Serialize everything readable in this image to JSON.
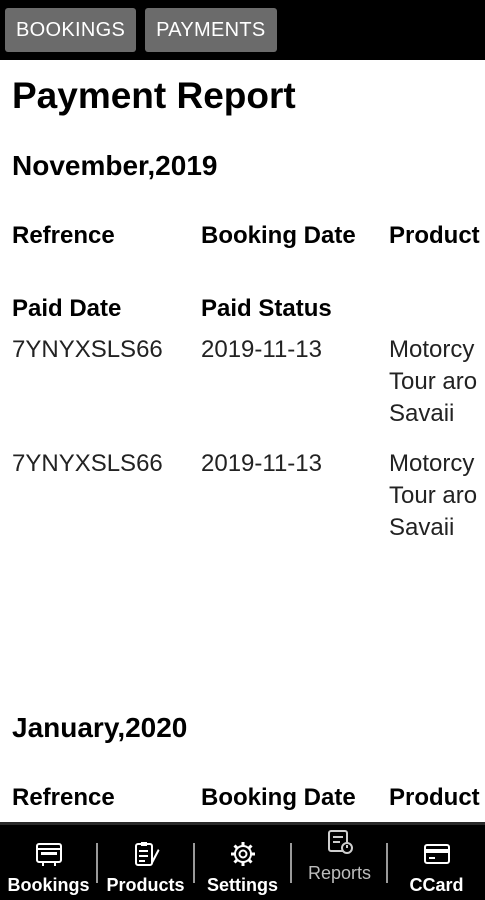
{
  "topbar": {
    "tabs": [
      {
        "label": "BOOKINGS"
      },
      {
        "label": "PAYMENTS"
      }
    ]
  },
  "page": {
    "title": "Payment Report"
  },
  "sections": [
    {
      "month": "November,2019",
      "headers": {
        "reference": "Refrence",
        "booking_date": "Booking Date",
        "product": "Product",
        "paid_date": "Paid Date",
        "paid_status": "Paid Status"
      },
      "rows": [
        {
          "reference": "7YNYXSLS66",
          "booking_date": "2019-11-13",
          "product_lines": [
            "Motorcy",
            "Tour aro",
            "Savaii"
          ]
        },
        {
          "reference": "7YNYXSLS66",
          "booking_date": "2019-11-13",
          "product_lines": [
            "Motorcy",
            "Tour aro",
            "Savaii"
          ]
        }
      ]
    },
    {
      "month": "January,2020",
      "headers": {
        "reference": "Refrence",
        "booking_date": "Booking Date",
        "product": "Product"
      }
    }
  ],
  "bottom_nav": [
    {
      "label": "Bookings",
      "icon": "bookings-icon"
    },
    {
      "label": "Products",
      "icon": "products-icon"
    },
    {
      "label": "Settings",
      "icon": "gear-icon"
    },
    {
      "label": "Reports",
      "icon": "reports-icon"
    },
    {
      "label": "CCard",
      "icon": "credit-card-icon"
    }
  ],
  "colors": {
    "bar_bg": "#000000",
    "tab_bg": "#6b6b6b",
    "content_bg": "#ffffff",
    "text": "#000000"
  }
}
